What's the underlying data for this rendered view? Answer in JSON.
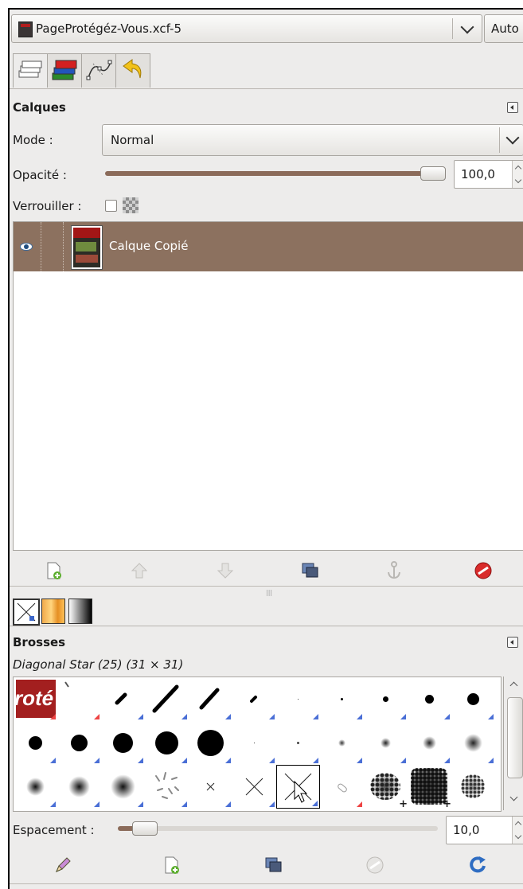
{
  "image_selector": {
    "label": "PageProtégéz-Vous.xcf-5",
    "auto_label": "Auto"
  },
  "layers": {
    "title": "Calques",
    "mode_label": "Mode :",
    "mode_value": "Normal",
    "opacity_label": "Opacité :",
    "opacity_value": "100,0",
    "opacity_fraction": 1.0,
    "lock_label": "Verrouiller :",
    "items": [
      {
        "name": "Calque Copié",
        "visible": true,
        "selected": true
      }
    ]
  },
  "layer_buttons": [
    "new-layer-icon",
    "raise-layer-icon",
    "lower-layer-icon",
    "duplicate-layer-icon",
    "anchor-layer-icon",
    "delete-layer-icon"
  ],
  "brushes": {
    "title": "Brosses",
    "current_brush": "Diagonal Star (25) (31 × 31)",
    "spacing_label": "Espacement :",
    "spacing_value": "10,0",
    "spacing_fraction": 0.1,
    "thumbnail_text": "roté"
  },
  "brush_buttons": [
    "edit-brush-icon",
    "new-brush-icon",
    "duplicate-brush-icon",
    "delete-brush-icon",
    "refresh-brushes-icon"
  ],
  "colors": {
    "selected_layer": "#8c715f",
    "slider": "#8b6b5a",
    "delete": "#d92b2b",
    "accent_blue": "#4a6fd6"
  }
}
